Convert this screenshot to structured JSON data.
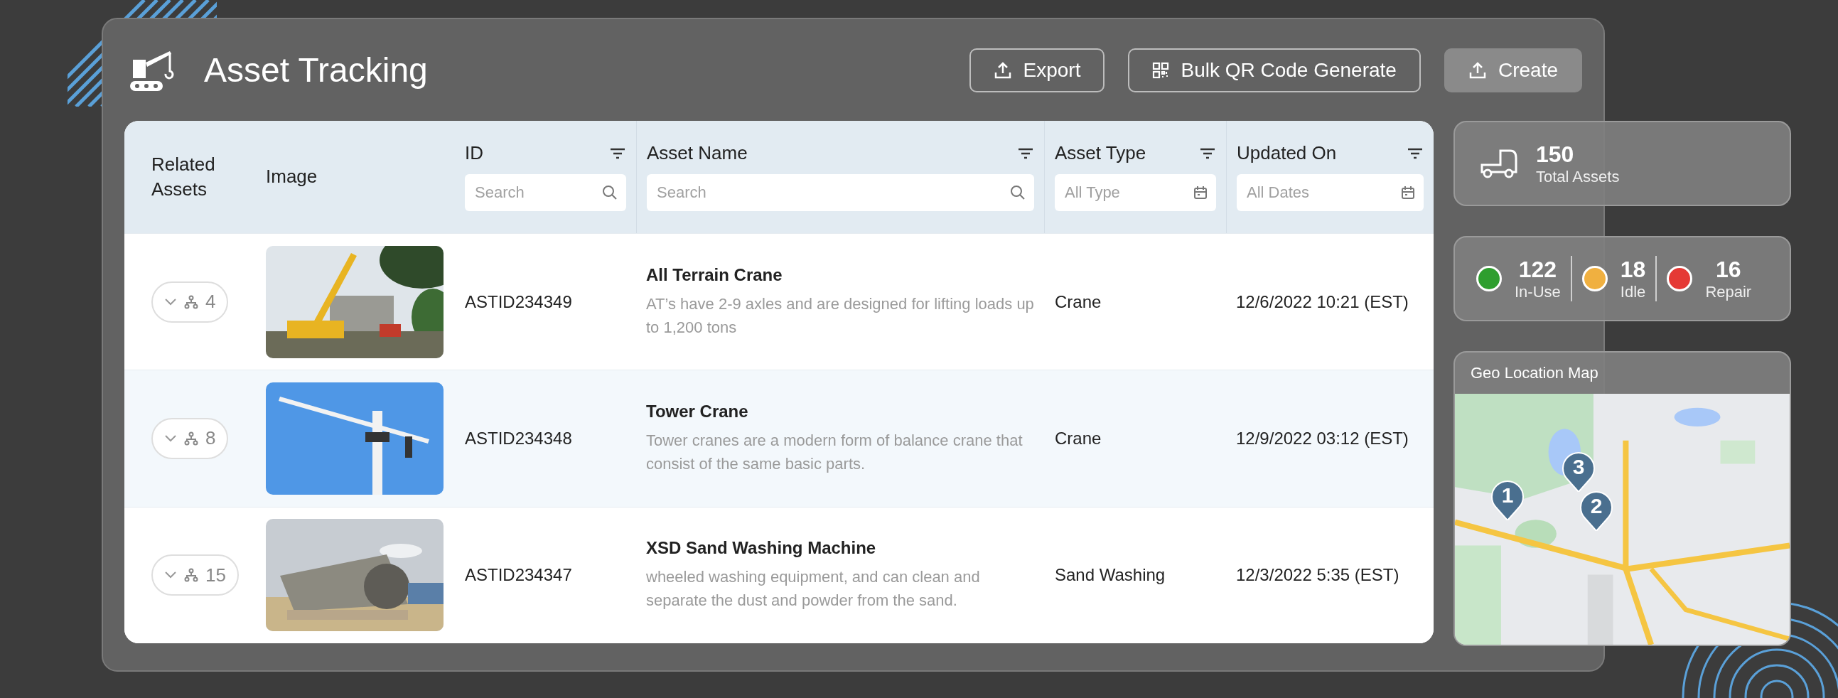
{
  "title": "Asset Tracking",
  "buttons": [
    {
      "label": "Export",
      "kind": "upload",
      "filled": false
    },
    {
      "label": "Bulk QR Code Generate",
      "kind": "qr",
      "filled": false
    },
    {
      "label": "Create",
      "kind": "upload",
      "filled": true
    }
  ],
  "table": {
    "columns": [
      {
        "label": "Related Assets",
        "filter": false
      },
      {
        "label": "Image",
        "filter": false
      },
      {
        "label": "ID",
        "filter": true,
        "field": {
          "kind": "search",
          "placeholder": "Search"
        }
      },
      {
        "label": "Asset Name",
        "filter": true,
        "field": {
          "kind": "search",
          "placeholder": "Search"
        }
      },
      {
        "label": "Asset Type",
        "filter": true,
        "field": {
          "kind": "date",
          "placeholder": "All Type"
        }
      },
      {
        "label": "Updated On",
        "filter": true,
        "field": {
          "kind": "date",
          "placeholder": "All Dates"
        }
      }
    ],
    "rows": [
      {
        "related": "4",
        "id": "ASTID234349",
        "name": "All Terrain Crane",
        "description": "AT’s have 2-9 axles and are designed for lifting loads up to 1,200 tons",
        "type": "Crane",
        "updated": "12/6/2022 10:21 (EST)",
        "highlighted": false
      },
      {
        "related": "8",
        "id": "ASTID234348",
        "name": "Tower Crane",
        "description": "Tower cranes are a modern form of balance crane that consist of the same basic parts.",
        "type": "Crane",
        "updated": "12/9/2022 03:12 (EST)",
        "highlighted": true
      },
      {
        "related": "15",
        "id": "ASTID234347",
        "name": "XSD Sand Washing Machine",
        "description": "wheeled washing equipment, and can clean and separate the dust and powder from the sand.",
        "type": "Sand Washing",
        "updated": "12/3/2022 5:35 (EST)",
        "highlighted": false
      }
    ]
  },
  "total": {
    "value": "150",
    "label": "Total Assets"
  },
  "statuses": [
    {
      "value": "122",
      "label": "In-Use",
      "color": "#2e9e2e"
    },
    {
      "value": "18",
      "label": "Idle",
      "color": "#f0b040"
    },
    {
      "value": "16",
      "label": "Repair",
      "color": "#e53935"
    }
  ],
  "map": {
    "title": "Geo Location Map",
    "pins": [
      "1",
      "2",
      "3"
    ]
  }
}
